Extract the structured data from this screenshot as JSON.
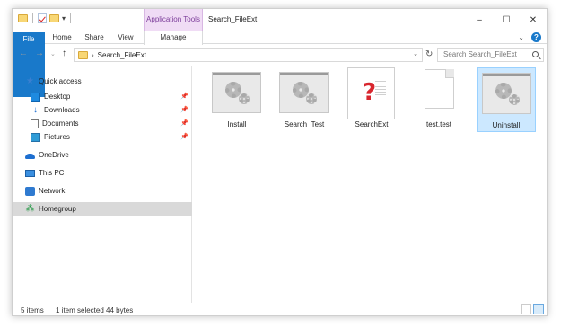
{
  "window": {
    "title": "Search_FileExt",
    "context_tab_header": "Application Tools",
    "controls": {
      "minimize": "–",
      "maximize": "☐",
      "close": "✕"
    }
  },
  "ribbon": {
    "tabs": [
      {
        "label": "File"
      },
      {
        "label": "Home"
      },
      {
        "label": "Share"
      },
      {
        "label": "View"
      },
      {
        "label": "Manage"
      }
    ],
    "help": "?"
  },
  "address_bar": {
    "path_segment": "Search_FileExt",
    "search_placeholder": "Search Search_FileExt"
  },
  "nav_pane": {
    "items": [
      {
        "label": "Quick access",
        "icon": "star-icon"
      },
      {
        "label": "Desktop",
        "icon": "desktop-icon",
        "pinned": true
      },
      {
        "label": "Downloads",
        "icon": "download-icon",
        "pinned": true
      },
      {
        "label": "Documents",
        "icon": "document-icon",
        "pinned": true
      },
      {
        "label": "Pictures",
        "icon": "pictures-icon",
        "pinned": true
      },
      {
        "label": "OneDrive",
        "icon": "cloud-icon"
      },
      {
        "label": "This PC",
        "icon": "computer-icon"
      },
      {
        "label": "Network",
        "icon": "network-icon"
      },
      {
        "label": "Homegroup",
        "icon": "homegroup-icon",
        "selected": true
      }
    ]
  },
  "files": [
    {
      "name": "Install",
      "icon": "application-gear-icon"
    },
    {
      "name": "Search_Test",
      "icon": "application-gear-icon"
    },
    {
      "name": "SearchExt",
      "icon": "help-document-icon"
    },
    {
      "name": "test.test",
      "icon": "blank-file-icon"
    },
    {
      "name": "Uninstall",
      "icon": "application-gear-icon",
      "selected": true
    }
  ],
  "status_bar": {
    "item_count": "5 items",
    "selection": "1 item selected",
    "size": "44 bytes"
  }
}
